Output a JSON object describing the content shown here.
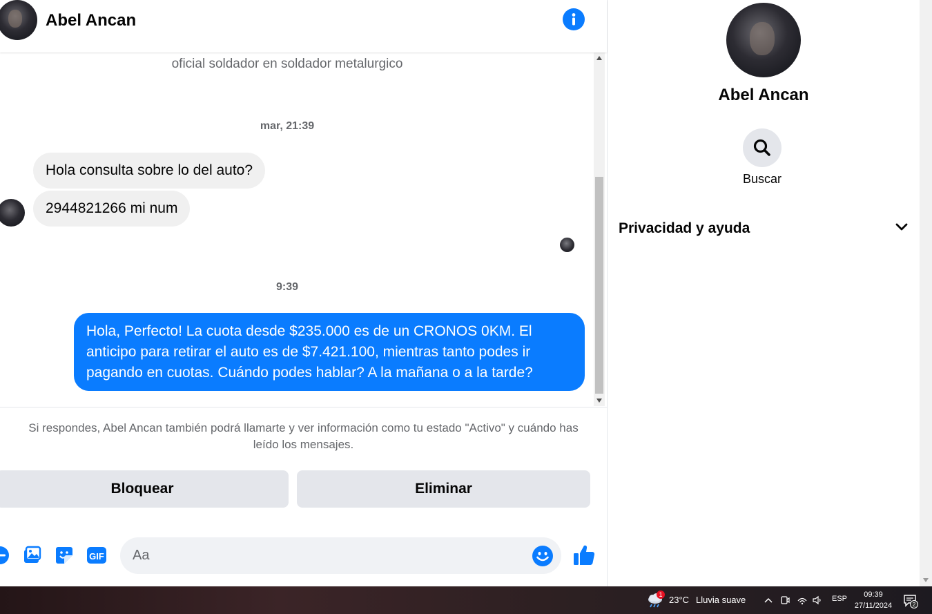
{
  "header": {
    "contact_name": "Abel Ancan",
    "info_icon": "info-icon"
  },
  "messages": {
    "work_line": "oficial soldador en soldador metalurgico",
    "timestamp_1": "mar, 21:39",
    "incoming": [
      "Hola consulta sobre lo del auto?",
      "2944821266 mi num"
    ],
    "timestamp_2": "9:39",
    "outgoing": [
      "Hola, Perfecto! La cuota desde $235.000 es de un CRONOS 0KM. El",
      "anticipo para retirar el auto es de $7.421.100, mientras tanto podes ir",
      "pagando en cuotas. Cuándo podes hablar? A la mañana o a la tarde?"
    ]
  },
  "notice": {
    "line1": "Si respondes, Abel Ancan también podrá llamarte y ver información como tu estado \"Activo\" y cuándo has",
    "line2": "leído los mensajes."
  },
  "actions": {
    "block_label": "Bloquear",
    "delete_label": "Eliminar"
  },
  "composer": {
    "placeholder": "Aa",
    "icons": [
      "plus-icon",
      "photo-icon",
      "sticker-icon",
      "gif-icon",
      "emoji-icon",
      "thumbs-up-icon"
    ],
    "gif_text": "GIF"
  },
  "panel": {
    "name": "Abel Ancan",
    "search_label": "Buscar",
    "privacy_label": "Privacidad y ayuda"
  },
  "taskbar": {
    "weather_badge": "1",
    "temperature": "23°C",
    "condition": "Lluvia suave",
    "language": "ESP",
    "time": "09:39",
    "date": "27/11/2024",
    "notification_count": "2"
  },
  "colors": {
    "accent": "#0a7cff",
    "incoming_bubble": "#f0f0f0",
    "button_bg": "#e4e6eb"
  }
}
